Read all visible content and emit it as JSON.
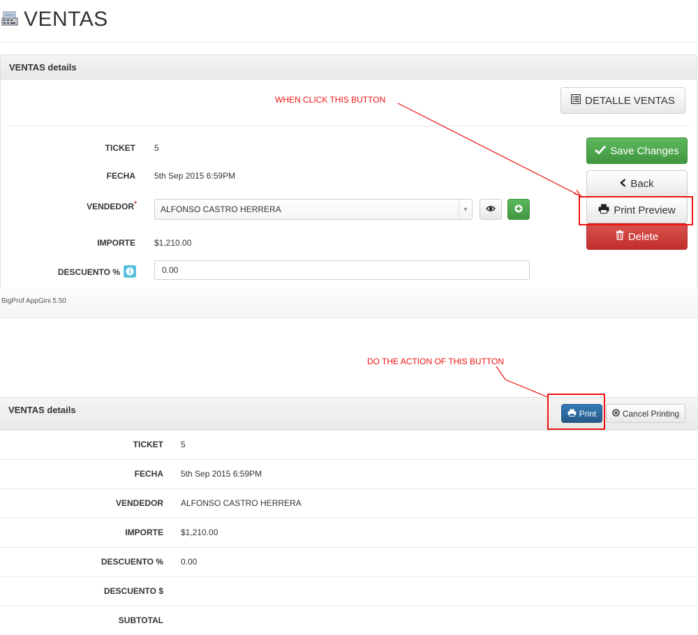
{
  "page": {
    "title": "VENTAS",
    "icon": "cash-register-icon"
  },
  "panel_edit": {
    "header": "VENTAS details",
    "detail_button": "DETALLE VENTAS",
    "fields": {
      "ticket": {
        "label": "TICKET",
        "value": "5"
      },
      "fecha": {
        "label": "FECHA",
        "value": "5th Sep 2015 6:59PM"
      },
      "vendedor": {
        "label": "VENDEDOR",
        "required_mark": "*",
        "value": "ALFONSO CASTRO HERRERA"
      },
      "importe": {
        "label": "IMPORTE",
        "value": "$1,210.00"
      },
      "descuento": {
        "label": "DESCUENTO %",
        "value": "0.00"
      }
    },
    "actions": {
      "save": "Save Changes",
      "back": "Back",
      "print_preview": "Print Preview",
      "delete": "Delete"
    }
  },
  "footer": {
    "text": "BigProf AppGini 5.50"
  },
  "annotations": {
    "top": "WHEN CLICK THIS BUTTON",
    "bottom": "DO THE ACTION OF THIS BUTTON",
    "color": "#ee1111"
  },
  "panel_print": {
    "header": "VENTAS details",
    "print_button": "Print",
    "cancel_button": "Cancel Printing",
    "rows": [
      {
        "label": "TICKET",
        "value": "5"
      },
      {
        "label": "FECHA",
        "value": "5th Sep 2015 6:59PM"
      },
      {
        "label": "VENDEDOR",
        "value": "ALFONSO CASTRO HERRERA"
      },
      {
        "label": "IMPORTE",
        "value": "$1,210.00"
      },
      {
        "label": "DESCUENTO %",
        "value": "0.00"
      },
      {
        "label": "DESCUENTO $",
        "value": ""
      },
      {
        "label": "SUBTOTAL",
        "value": ""
      }
    ]
  },
  "colors": {
    "success": "#5cb85c",
    "danger": "#d9534f",
    "primary": "#337ab7",
    "info": "#5bc0de",
    "annotation": "#ee1111"
  }
}
